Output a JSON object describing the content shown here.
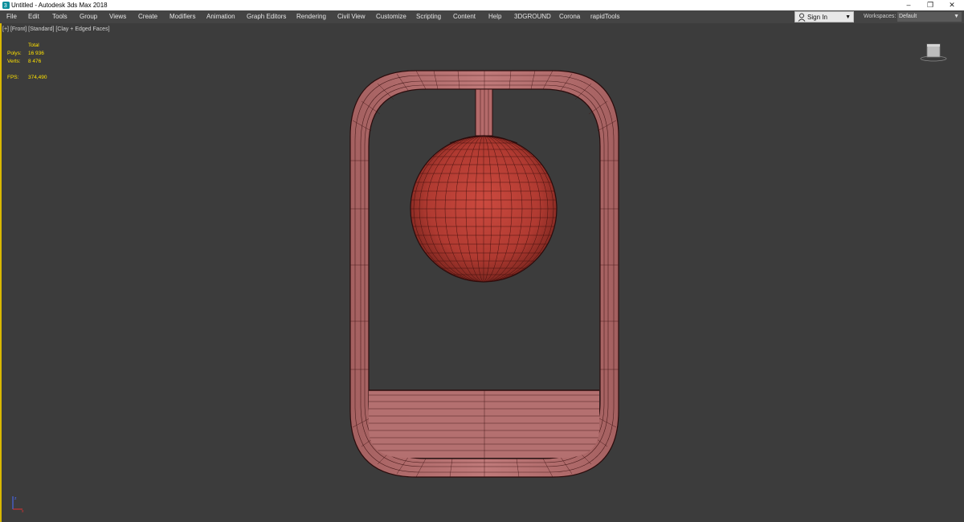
{
  "window": {
    "title": "Untitled - Autodesk 3ds Max 2018",
    "buttons": {
      "minimize": "–",
      "restore": "❐",
      "close": "✕"
    }
  },
  "menu": {
    "items": [
      "File",
      "Edit",
      "Tools",
      "Group",
      "Views",
      "Create",
      "Modifiers",
      "Animation",
      "Graph Editors",
      "Rendering",
      "Civil View",
      "Customize",
      "Scripting",
      "Content",
      "Help",
      "3DGROUND",
      "Corona",
      "rapidTools"
    ]
  },
  "account": {
    "sign_in": "Sign In"
  },
  "workspace": {
    "label": "Workspaces:",
    "value": "Default"
  },
  "viewport": {
    "labels": {
      "plus": "[+]",
      "view": "[Front]",
      "shading": "[Standard]",
      "style": "[Clay + Edged Faces]"
    },
    "stats": {
      "total_header": "Total",
      "polys_label": "Polys:",
      "polys_value": "16 936",
      "verts_label": "Verts:",
      "verts_value": "8 476",
      "fps_label": "FPS:",
      "fps_value": "374,490"
    },
    "axis_icon": "xyz-axis-icon",
    "viewcube_icon": "viewcube-icon"
  },
  "colors": {
    "titlebar_bg": "#ffffff",
    "menubar_bg": "#444444",
    "viewport_bg": "#3c3c3c",
    "viewport_border": "#d9b800",
    "stats_text": "#ffe200",
    "frame_fill": "#b67272",
    "ball_fill": "#b53a32",
    "wire_color": "#3a1010"
  }
}
